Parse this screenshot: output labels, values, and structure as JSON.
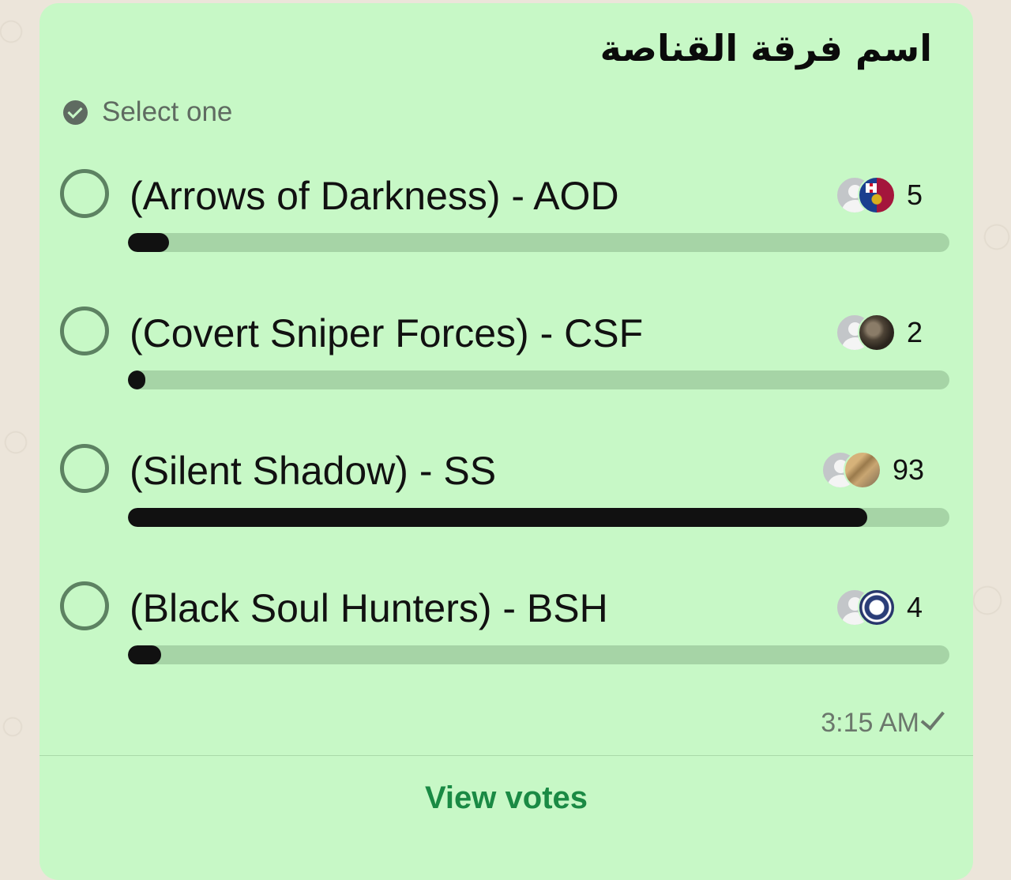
{
  "poll": {
    "question": "اسم فرقة القناصة",
    "select_hint": "Select one",
    "options": [
      {
        "label": "(Arrows of Darkness) - AOD",
        "votes": "5",
        "share": 0.05,
        "voter_avatars": [
          "default-avatar",
          "fc-barcelona-crest-avatar"
        ]
      },
      {
        "label": "(Covert Sniper Forces) - CSF",
        "votes": "2",
        "share": 0.02,
        "voter_avatars": [
          "default-avatar",
          "dark-photo-avatar"
        ]
      },
      {
        "label": "(Silent Shadow) - SS",
        "votes": "93",
        "share": 0.9,
        "voter_avatars": [
          "default-avatar",
          "photo-avatar"
        ]
      },
      {
        "label": "(Black Soul Hunters) - BSH",
        "votes": "4",
        "share": 0.04,
        "voter_avatars": [
          "default-avatar",
          "navy-logo-avatar"
        ]
      }
    ],
    "timestamp": "3:15 AM",
    "view_votes_label": "View votes"
  },
  "colors": {
    "bubble_bg": "#c7f8c6",
    "radio_border": "#5d8262",
    "progress_track": "#a6d4a6",
    "progress_fill": "#111111",
    "link_green": "#1a8a44"
  }
}
